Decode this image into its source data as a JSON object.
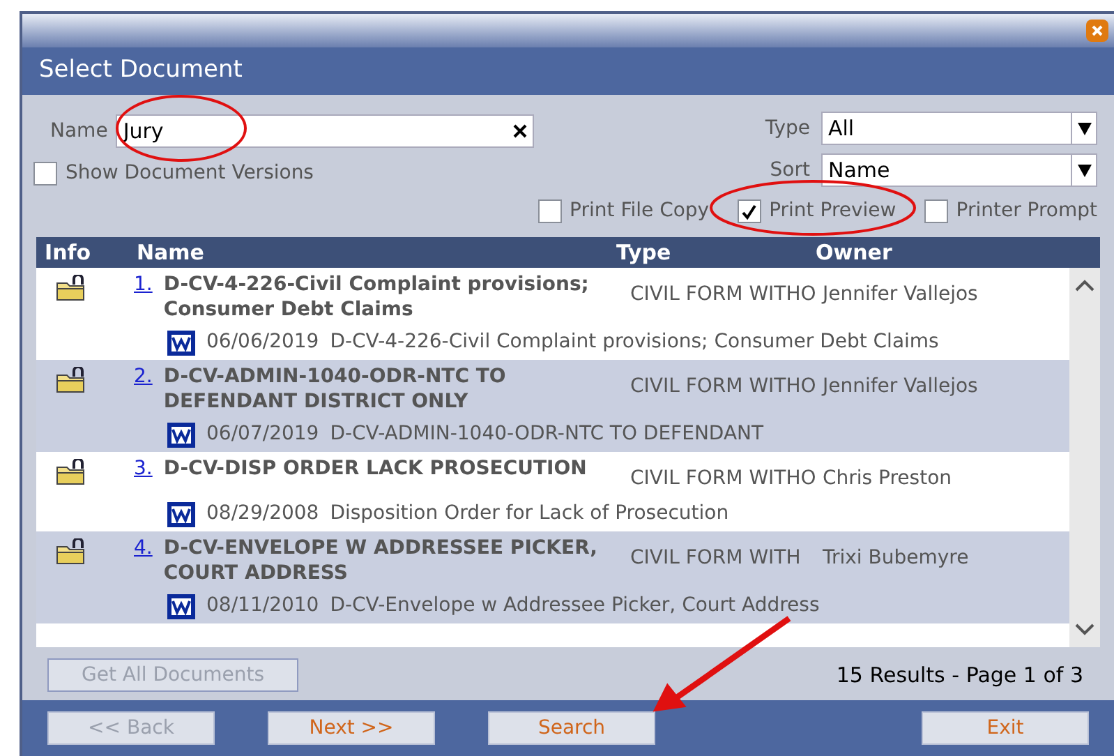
{
  "window": {
    "title": "Select Document"
  },
  "name_field": {
    "label": "Name",
    "value": "Jury"
  },
  "show_versions": {
    "label": "Show Document Versions",
    "checked": false
  },
  "type_select": {
    "label": "Type",
    "value": "All"
  },
  "sort_select": {
    "label": "Sort",
    "value": "Name"
  },
  "print_options": [
    {
      "label": "Print File Copy",
      "checked": false
    },
    {
      "label": "Print Preview",
      "checked": true
    },
    {
      "label": "Printer Prompt",
      "checked": false
    }
  ],
  "table": {
    "columns": [
      "Info",
      "Name",
      "Type",
      "Owner"
    ],
    "rows": [
      {
        "number": "1.",
        "name": "D-CV-4-226-Civil Complaint provisions; Consumer Debt Claims",
        "type": "CIVIL FORM WITHO",
        "owner": "Jennifer Vallejos",
        "date": "06/06/2019",
        "description": "D-CV-4-226-Civil Complaint provisions; Consumer Debt Claims"
      },
      {
        "number": "2.",
        "name": "D-CV-ADMIN-1040-ODR-NTC TO DEFENDANT DISTRICT ONLY",
        "type": "CIVIL FORM WITHO",
        "owner": "Jennifer Vallejos",
        "date": "06/07/2019",
        "description": "D-CV-ADMIN-1040-ODR-NTC TO DEFENDANT"
      },
      {
        "number": "3.",
        "name": "D-CV-DISP ORDER LACK PROSECUTION",
        "type": "CIVIL FORM WITHO",
        "owner": "Chris Preston",
        "date": "08/29/2008",
        "description": "Disposition Order for Lack of Prosecution"
      },
      {
        "number": "4.",
        "name": "D-CV-ENVELOPE W ADDRESSEE PICKER, COURT ADDRESS",
        "type": "CIVIL FORM WITH",
        "owner": "Trixi Bubemyre",
        "date": "08/11/2010",
        "description": "D-CV-Envelope w Addressee Picker, Court Address"
      }
    ]
  },
  "get_all": {
    "label": "Get All Documents",
    "disabled": true
  },
  "results": "15 Results - Page 1 of 3",
  "footer_buttons": [
    {
      "label": "<< Back",
      "disabled": true
    },
    {
      "label": "Next >>",
      "disabled": false
    },
    {
      "label": "Search",
      "disabled": false
    },
    {
      "label": "Exit",
      "disabled": false
    }
  ]
}
